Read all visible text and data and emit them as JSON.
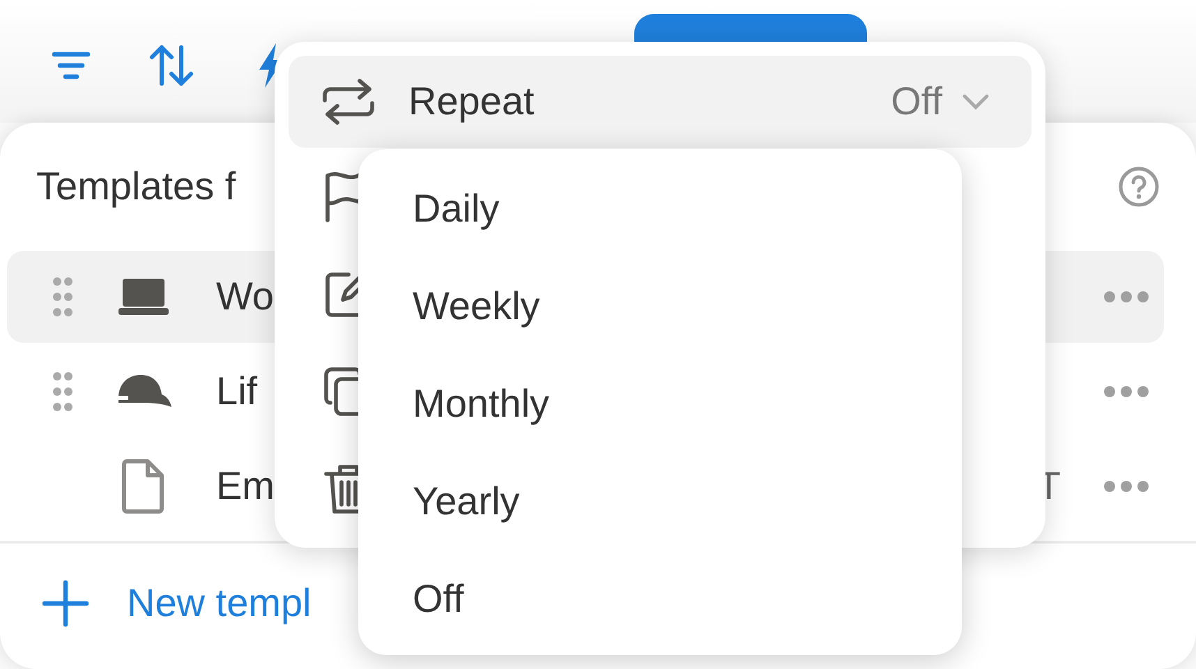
{
  "panel": {
    "title": "Templates f",
    "rows": [
      {
        "label": "Wo",
        "selected": true,
        "drag_handle": true
      },
      {
        "label": "Lif",
        "selected": false,
        "drag_handle": true
      },
      {
        "label": "Em",
        "selected": false,
        "drag_handle": false,
        "trailing": "T"
      }
    ],
    "new_button": "New templ"
  },
  "menu": {
    "repeat": {
      "label": "Repeat",
      "value": "Off",
      "highlighted": true
    }
  },
  "submenu": {
    "options": [
      "Daily",
      "Weekly",
      "Monthly",
      "Yearly",
      "Off"
    ]
  }
}
